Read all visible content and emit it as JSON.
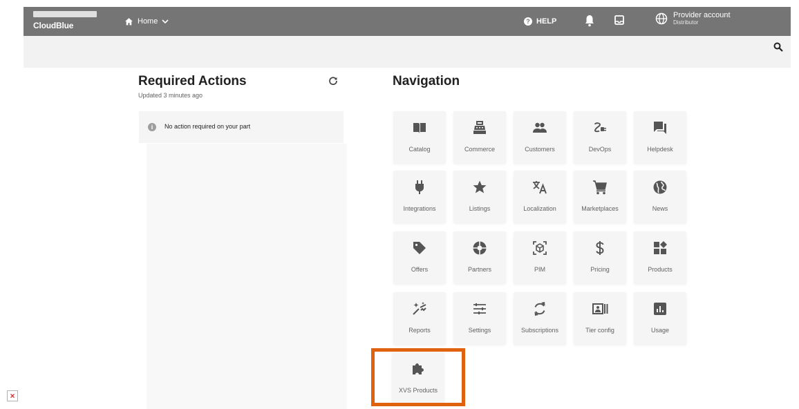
{
  "topbar": {
    "logo_text": "CloudBlue",
    "home_label": "Home",
    "help_label": "HELP",
    "account_name": "Provider account",
    "account_role": "Distributor"
  },
  "required_actions": {
    "title": "Required Actions",
    "updated": "Updated 3 minutes ago",
    "alert_text": "No action required on your part"
  },
  "navigation": {
    "title": "Navigation",
    "tiles": [
      {
        "label": "Catalog",
        "icon": "book-icon"
      },
      {
        "label": "Commerce",
        "icon": "cash-register-icon"
      },
      {
        "label": "Customers",
        "icon": "people-icon"
      },
      {
        "label": "DevOps",
        "icon": "devops-icon"
      },
      {
        "label": "Helpdesk",
        "icon": "chat-icon"
      },
      {
        "label": "Integrations",
        "icon": "plug-icon"
      },
      {
        "label": "Listings",
        "icon": "star-icon"
      },
      {
        "label": "Localization",
        "icon": "translate-icon"
      },
      {
        "label": "Marketplaces",
        "icon": "cart-icon"
      },
      {
        "label": "News",
        "icon": "globe-icon"
      },
      {
        "label": "Offers",
        "icon": "tag-icon"
      },
      {
        "label": "Partners",
        "icon": "partners-icon"
      },
      {
        "label": "PIM",
        "icon": "pim-icon"
      },
      {
        "label": "Pricing",
        "icon": "dollar-icon"
      },
      {
        "label": "Products",
        "icon": "products-icon"
      },
      {
        "label": "Reports",
        "icon": "sparkle-icon"
      },
      {
        "label": "Settings",
        "icon": "sliders-icon"
      },
      {
        "label": "Subscriptions",
        "icon": "sync-icon"
      },
      {
        "label": "Tier config",
        "icon": "tier-config-icon"
      },
      {
        "label": "Usage",
        "icon": "usage-chart-icon"
      },
      {
        "label": "XVS Products",
        "icon": "puzzle-icon"
      }
    ]
  },
  "colors": {
    "topbar": "#757575",
    "highlight": "#e0620e",
    "tile_bg": "#f5f5f5",
    "icon": "#555555"
  }
}
